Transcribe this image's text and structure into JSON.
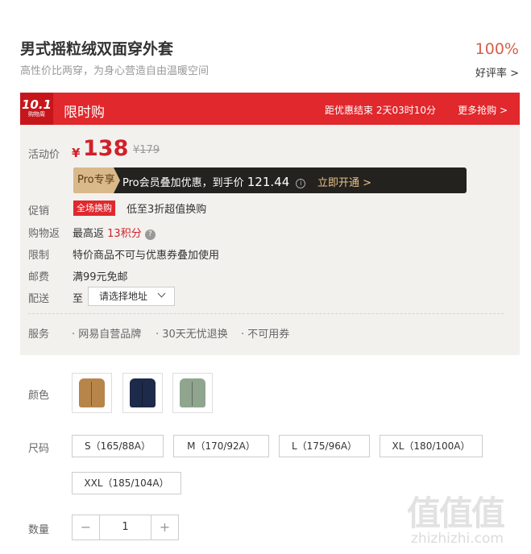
{
  "product": {
    "title": "男式摇粒绒双面穿外套",
    "subtitle": "高性价比两穿，为身心营造自由温暖空间",
    "rating_pct": "100%",
    "rating_label": "好评率 >"
  },
  "flash_sale": {
    "logo_big": "10.1",
    "logo_small": "购物周",
    "title": "限时购",
    "countdown": "距优惠结束 2天03时10分",
    "more": "更多抢购 >"
  },
  "pricing": {
    "label": "活动价",
    "currency": "¥",
    "price": "138",
    "original": "¥179",
    "pro_tag": "Pro专享",
    "pro_text": "Pro会员叠加优惠，到手价",
    "pro_price": "121.44",
    "pro_info_icon": "i",
    "pro_open": "立即开通 >"
  },
  "rows": {
    "promo_label": "促销",
    "promo_badge": "全场换购",
    "promo_text": "低至3折超值换购",
    "rebate_label": "购物返",
    "rebate_prefix": "最高返",
    "rebate_points": "13积分",
    "rebate_help_icon": "?",
    "limit_label": "限制",
    "limit_text": "特价商品不可与优惠券叠加使用",
    "postage_label": "邮费",
    "postage_text": "满99元免邮",
    "delivery_label": "配送",
    "delivery_to": "至",
    "delivery_select": "请选择地址"
  },
  "service": {
    "label": "服务",
    "items": [
      "· 网易自营品牌",
      "· 30天无忧退换",
      "· 不可用券"
    ]
  },
  "color": {
    "label": "颜色",
    "swatches": [
      {
        "name": "tan-jacket",
        "color": "#b7844a"
      },
      {
        "name": "navy-jacket",
        "color": "#1e2a4a"
      },
      {
        "name": "sage-jacket",
        "color": "#8fa58e"
      }
    ]
  },
  "size": {
    "label": "尺码",
    "options": [
      "S（165/88A）",
      "M（170/92A）",
      "L（175/96A）",
      "XL（180/100A）",
      "XXL（185/104A）"
    ]
  },
  "quantity": {
    "label": "数量",
    "minus": "−",
    "value": "1",
    "plus": "+"
  },
  "watermark": {
    "big": "值值值",
    "small": "zhizhizhi.com"
  }
}
